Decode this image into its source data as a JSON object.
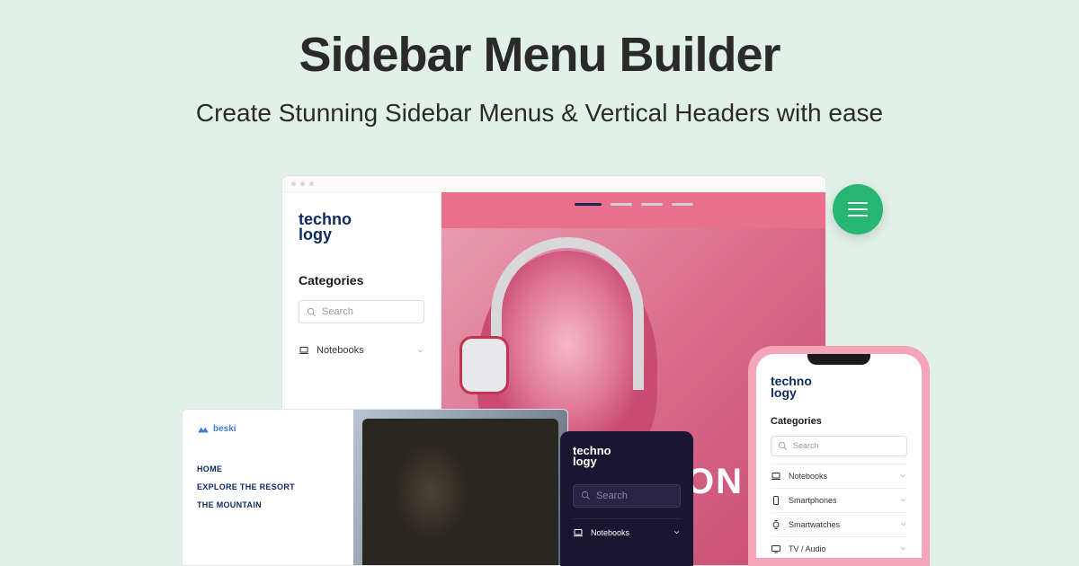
{
  "hero": {
    "title": "Sidebar Menu Builder",
    "subtitle": "Create Stunning Sidebar Menus & Vertical Headers with ease"
  },
  "browser": {
    "logo_line1": "techno",
    "logo_line2": "logy",
    "categories_heading": "Categories",
    "search_placeholder": "Search",
    "menu": [
      {
        "label": "Notebooks",
        "icon": "laptop"
      }
    ],
    "hero_text": "HEADPHON"
  },
  "site2": {
    "logo": "beski",
    "nav": [
      "HOME",
      "EXPLORE THE RESORT",
      "THE MOUNTAIN"
    ]
  },
  "dark": {
    "logo_line1": "techno",
    "logo_line2": "logy",
    "search_placeholder": "Search",
    "menu": [
      {
        "label": "Notebooks",
        "icon": "laptop"
      }
    ]
  },
  "phone": {
    "logo_line1": "techno",
    "logo_line2": "logy",
    "categories_heading": "Categories",
    "search_placeholder": "Search",
    "menu": [
      {
        "label": "Notebooks",
        "icon": "laptop"
      },
      {
        "label": "Smartphones",
        "icon": "phone"
      },
      {
        "label": "Smartwatches",
        "icon": "watch"
      },
      {
        "label": "TV / Audio",
        "icon": "tv"
      }
    ]
  }
}
